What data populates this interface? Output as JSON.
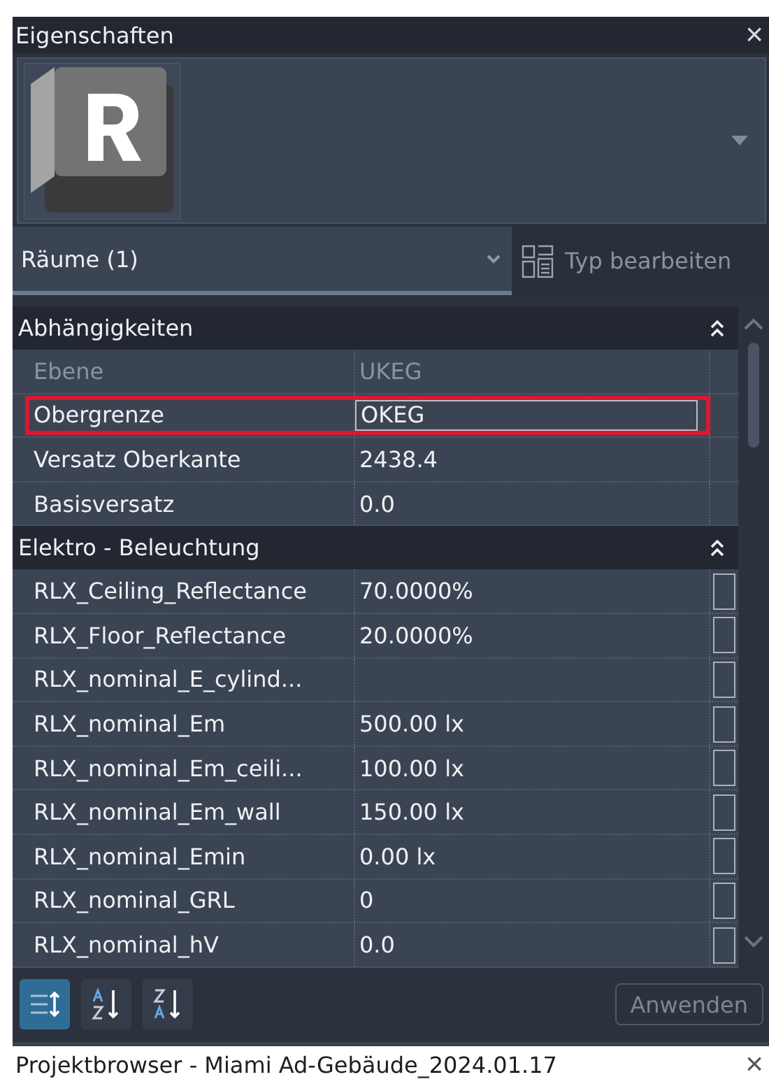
{
  "window": {
    "title": "Eigenschaften",
    "close": "×"
  },
  "instance": {
    "label": "Räume (1)",
    "edit_type_button": {
      "label": "Typ bearbeiten",
      "disabled": true
    }
  },
  "groups": [
    {
      "title": "Abhängigkeiten",
      "expanded": true,
      "rows": [
        {
          "name": "Ebene",
          "value": "UKEG",
          "disabled": true,
          "highlighted": false
        },
        {
          "name": "Obergrenze",
          "value": "OKEG",
          "disabled": false,
          "highlighted": true
        },
        {
          "name": "Versatz Oberkante",
          "value": "2438.4",
          "disabled": false,
          "highlighted": false
        },
        {
          "name": "Basisversatz",
          "value": "0.0",
          "disabled": false,
          "highlighted": false
        }
      ]
    },
    {
      "title": "Elektro - Beleuchtung",
      "expanded": true,
      "rows": [
        {
          "name": "RLX_Ceiling_Reflectance",
          "value": "70.0000%",
          "disabled": false,
          "highlighted": false,
          "checked": false
        },
        {
          "name": "RLX_Floor_Reflectance",
          "value": "20.0000%",
          "disabled": false,
          "highlighted": false,
          "checked": false
        },
        {
          "name": "RLX_nominal_E_cylind...",
          "value": "",
          "disabled": false,
          "highlighted": false,
          "checked": false
        },
        {
          "name": "RLX_nominal_Em",
          "value": "500.00 lx",
          "disabled": false,
          "highlighted": false,
          "checked": false
        },
        {
          "name": "RLX_nominal_Em_ceili...",
          "value": "100.00 lx",
          "disabled": false,
          "highlighted": false,
          "checked": false
        },
        {
          "name": "RLX_nominal_Em_wall",
          "value": "150.00 lx",
          "disabled": false,
          "highlighted": false,
          "checked": false
        },
        {
          "name": "RLX_nominal_Emin",
          "value": "0.00 lx",
          "disabled": false,
          "highlighted": false,
          "checked": false
        },
        {
          "name": "RLX_nominal_GRL",
          "value": "0",
          "disabled": false,
          "highlighted": false,
          "checked": false
        },
        {
          "name": "RLX_nominal_hV",
          "value": "0.0",
          "disabled": false,
          "highlighted": false,
          "checked": false
        }
      ]
    }
  ],
  "toolbar": {
    "buttons": [
      {
        "kind": "categorized",
        "selected": true
      },
      {
        "kind": "ascending",
        "selected": false
      },
      {
        "kind": "descending",
        "selected": false
      }
    ],
    "apply_button": {
      "label": "Anwenden",
      "disabled": true
    }
  },
  "bottom_panel": {
    "title": "Projektbrowser - Miami Ad-Gebäude_2024.01.17",
    "close": "×"
  }
}
